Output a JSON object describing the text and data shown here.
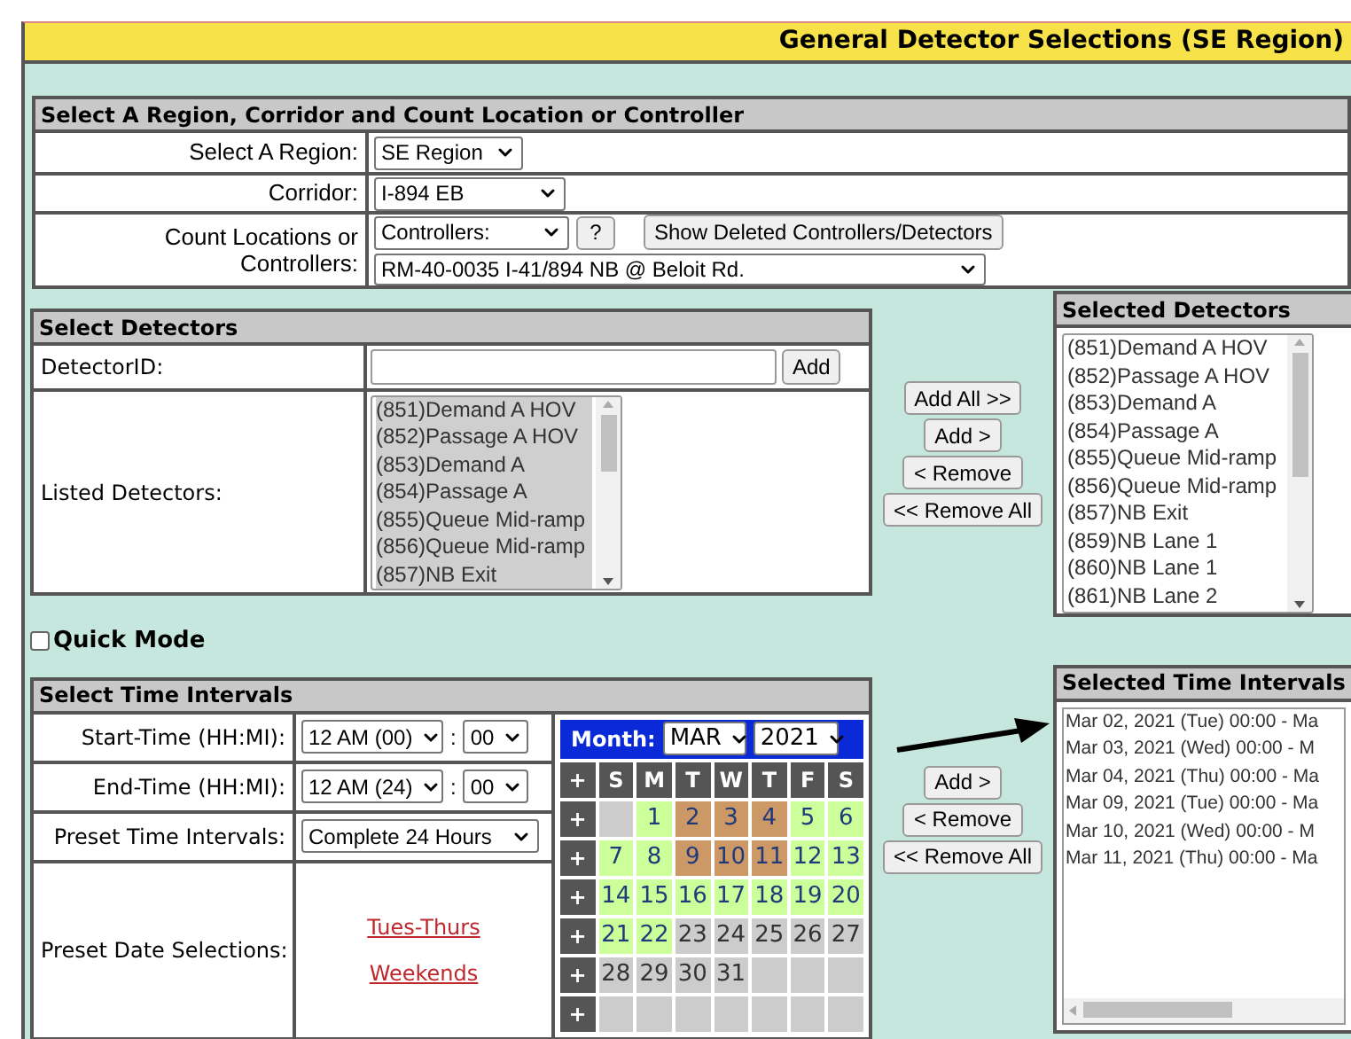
{
  "title": "General Detector Selections (SE Region)",
  "region_section": {
    "heading": "Select A Region, Corridor and Count Location or Controller",
    "region": {
      "label": "Select A Region:",
      "value": "SE Region"
    },
    "corridor": {
      "label": "Corridor:",
      "value": "I-894 EB"
    },
    "count_locations": {
      "label": "Count Locations or Controllers:",
      "type_value": "Controllers:",
      "help_button": "?",
      "show_deleted_button": "Show Deleted Controllers/Detectors",
      "controller_value": "RM-40-0035 I-41/894 NB @ Beloit Rd."
    }
  },
  "detectors_section": {
    "heading": "Select Detectors",
    "detector_id_label": "DetectorID:",
    "add_button": "Add",
    "listed_label": "Listed Detectors:",
    "listed": [
      {
        "text": "(851)Demand A HOV",
        "selected": true
      },
      {
        "text": "(852)Passage A HOV",
        "selected": true
      },
      {
        "text": "(853)Demand A",
        "selected": true
      },
      {
        "text": "(854)Passage A",
        "selected": true
      },
      {
        "text": "(855)Queue Mid-ramp",
        "selected": true
      },
      {
        "text": "(856)Queue Mid-ramp",
        "selected": true
      },
      {
        "text": "(857)NB Exit",
        "selected": true
      }
    ]
  },
  "detector_buttons": [
    "Add All >>",
    "Add >",
    "< Remove",
    "<< Remove All"
  ],
  "selected_detectors": {
    "heading": "Selected Detectors",
    "items": [
      {
        "text": "(851)Demand A HOV",
        "selected": false
      },
      {
        "text": "(852)Passage A HOV",
        "selected": false
      },
      {
        "text": "(853)Demand A",
        "selected": false
      },
      {
        "text": "(854)Passage A",
        "selected": false
      },
      {
        "text": "(855)Queue Mid-ramp",
        "selected": false
      },
      {
        "text": "(856)Queue Mid-ramp",
        "selected": false
      },
      {
        "text": "(857)NB Exit",
        "selected": false
      },
      {
        "text": "(859)NB Lane 1",
        "selected": false
      },
      {
        "text": "(860)NB Lane 1",
        "selected": false
      },
      {
        "text": "(861)NB Lane 2",
        "selected": false
      }
    ]
  },
  "quick_mode": {
    "label": "Quick Mode",
    "checked": false
  },
  "time_section": {
    "heading": "Select Time Intervals",
    "start": {
      "label": "Start-Time (HH:MI):",
      "hour": "12 AM (00)",
      "separator": ":",
      "minute": "00"
    },
    "end": {
      "label": "End-Time (HH:MI):",
      "hour": "12 AM (24)",
      "separator": ":",
      "minute": "00"
    },
    "preset_intervals": {
      "label": "Preset Time Intervals:",
      "value": "Complete 24 Hours"
    },
    "preset_dates": {
      "label": "Preset Date Selections:",
      "links": [
        "Tues-Thurs",
        "Weekends"
      ]
    }
  },
  "calendar": {
    "month_label": "Month:",
    "month": "MAR",
    "year": "2021",
    "corner": "+",
    "weekdays": [
      "S",
      "M",
      "T",
      "W",
      "T",
      "F",
      "S"
    ],
    "weeks": [
      {
        "plus": "+",
        "days": [
          {
            "available": false,
            "selected": false
          },
          {
            "day": "1",
            "available": true,
            "selected": false
          },
          {
            "day": "2",
            "available": true,
            "selected": true
          },
          {
            "day": "3",
            "available": true,
            "selected": true
          },
          {
            "day": "4",
            "available": true,
            "selected": true
          },
          {
            "day": "5",
            "available": true,
            "selected": false
          },
          {
            "day": "6",
            "available": true,
            "selected": false
          }
        ]
      },
      {
        "plus": "+",
        "days": [
          {
            "day": "7",
            "available": true,
            "selected": false
          },
          {
            "day": "8",
            "available": true,
            "selected": false
          },
          {
            "day": "9",
            "available": true,
            "selected": true
          },
          {
            "day": "10",
            "available": true,
            "selected": true
          },
          {
            "day": "11",
            "available": true,
            "selected": true
          },
          {
            "day": "12",
            "available": true,
            "selected": false
          },
          {
            "day": "13",
            "available": true,
            "selected": false
          }
        ]
      },
      {
        "plus": "+",
        "days": [
          {
            "day": "14",
            "available": true,
            "selected": false
          },
          {
            "day": "15",
            "available": true,
            "selected": false
          },
          {
            "day": "16",
            "available": true,
            "selected": false
          },
          {
            "day": "17",
            "available": true,
            "selected": false
          },
          {
            "day": "18",
            "available": true,
            "selected": false
          },
          {
            "day": "19",
            "available": true,
            "selected": false
          },
          {
            "day": "20",
            "available": true,
            "selected": false
          }
        ]
      },
      {
        "plus": "+",
        "days": [
          {
            "day": "21",
            "available": true,
            "selected": false
          },
          {
            "day": "22",
            "available": true,
            "selected": false
          },
          {
            "day": "23",
            "available": false,
            "selected": false
          },
          {
            "day": "24",
            "available": false,
            "selected": false
          },
          {
            "day": "25",
            "available": false,
            "selected": false
          },
          {
            "day": "26",
            "available": false,
            "selected": false
          },
          {
            "day": "27",
            "available": false,
            "selected": false
          }
        ]
      },
      {
        "plus": "+",
        "days": [
          {
            "day": "28",
            "available": false,
            "selected": false
          },
          {
            "day": "29",
            "available": false,
            "selected": false
          },
          {
            "day": "30",
            "available": false,
            "selected": false
          },
          {
            "day": "31",
            "available": false,
            "selected": false
          },
          {
            "available": false,
            "selected": false
          },
          {
            "available": false,
            "selected": false
          },
          {
            "available": false,
            "selected": false
          }
        ]
      },
      {
        "plus": "+",
        "days": [
          {
            "available": false,
            "selected": false
          },
          {
            "available": false,
            "selected": false
          },
          {
            "available": false,
            "selected": false
          },
          {
            "available": false,
            "selected": false
          },
          {
            "available": false,
            "selected": false
          },
          {
            "available": false,
            "selected": false
          },
          {
            "available": false,
            "selected": false
          }
        ]
      }
    ]
  },
  "time_buttons": [
    "Add >",
    "< Remove",
    "<< Remove All"
  ],
  "selected_intervals": {
    "heading": "Selected Time Intervals",
    "items": [
      "Mar 02, 2021 (Tue) 00:00 - Ma",
      "Mar 03, 2021 (Wed) 00:00 - M",
      "Mar 04, 2021 (Thu) 00:00 - Ma",
      "Mar 09, 2021 (Tue) 00:00 - Ma",
      "Mar 10, 2021 (Wed) 00:00 - M",
      "Mar 11, 2021 (Thu) 00:00 - Ma"
    ]
  }
}
